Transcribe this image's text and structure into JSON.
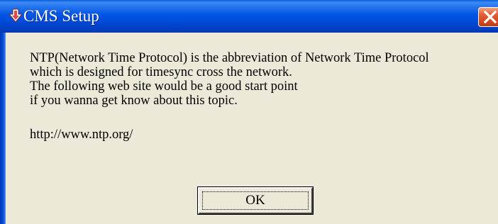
{
  "window": {
    "title": "CMS Setup",
    "title_icon": "app-download-arrow-icon",
    "close_icon": "close-x-icon"
  },
  "message": {
    "lines": [
      "NTP(Network Time Protocol) is the abbreviation of Network Time Protocol",
      "which is designed for timesync cross the network.",
      "The following web site would be a good start point",
      "if you wanna get know about this topic."
    ],
    "url": "http://www.ntp.org/"
  },
  "buttons": {
    "ok_label": "OK"
  },
  "colors": {
    "titlebar": "#0055e5",
    "dialog_background": "#ece9d8",
    "close_button": "#d34a22"
  }
}
